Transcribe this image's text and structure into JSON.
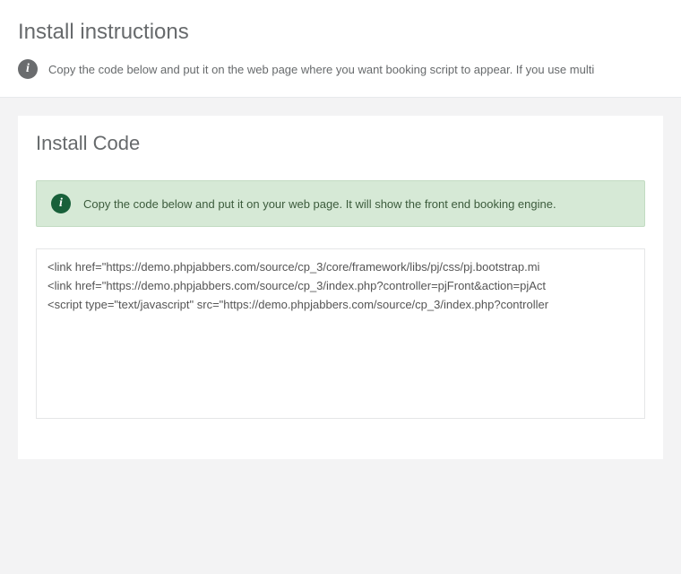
{
  "header": {
    "title": "Install instructions",
    "description": "Copy the code below and put it on the web page where you want booking script to appear. If you use multi"
  },
  "panel": {
    "title": "Install Code",
    "alert": "Copy the code below and put it on your web page. It will show the front end booking engine.",
    "code": "<link href=\"https://demo.phpjabbers.com/source/cp_3/core/framework/libs/pj/css/pj.bootstrap.mi\n<link href=\"https://demo.phpjabbers.com/source/cp_3/index.php?controller=pjFront&action=pjAct\n<script type=\"text/javascript\" src=\"https://demo.phpjabbers.com/source/cp_3/index.php?controller"
  }
}
